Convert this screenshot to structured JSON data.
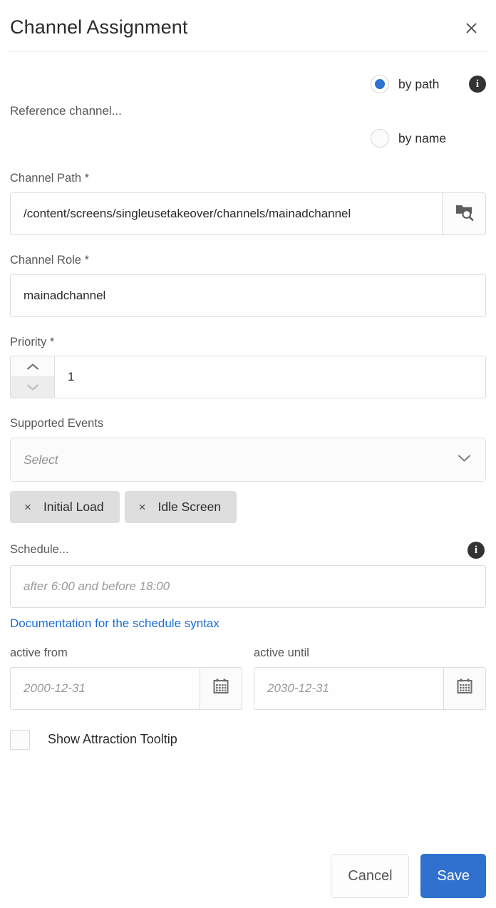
{
  "dialog": {
    "title": "Channel Assignment",
    "close_label": "×"
  },
  "reference_channel": {
    "label": "Reference channel...",
    "info_glyph": "i",
    "options": [
      {
        "label": "by path",
        "selected": true
      },
      {
        "label": "by name",
        "selected": false
      }
    ]
  },
  "channel_path": {
    "label": "Channel Path *",
    "value": "/content/screens/singleusetakeover/channels/mainadchannel",
    "browse_title": "Browse"
  },
  "channel_role": {
    "label": "Channel Role *",
    "value": "mainadchannel"
  },
  "priority": {
    "label": "Priority *",
    "value": "1"
  },
  "supported_events": {
    "label": "Supported Events",
    "placeholder": "Select",
    "chips": [
      {
        "label": "Initial Load",
        "remove": "×"
      },
      {
        "label": "Idle Screen",
        "remove": "×"
      }
    ]
  },
  "schedule": {
    "label": "Schedule...",
    "placeholder": "after 6:00 and before 18:00",
    "info_glyph": "i",
    "doc_link": "Documentation for the schedule syntax"
  },
  "active_from": {
    "label": "active from",
    "placeholder": "2000-12-31"
  },
  "active_until": {
    "label": "active until",
    "placeholder": "2030-12-31"
  },
  "attraction_tooltip": {
    "label": "Show Attraction Tooltip",
    "checked": false
  },
  "footer": {
    "cancel_label": "Cancel",
    "save_label": "Save"
  },
  "colors": {
    "accent": "#2d72d2",
    "primary_button": "#3071cd",
    "link": "#1a6dd4",
    "chip_background": "#dedede",
    "info_icon": "#333333"
  }
}
